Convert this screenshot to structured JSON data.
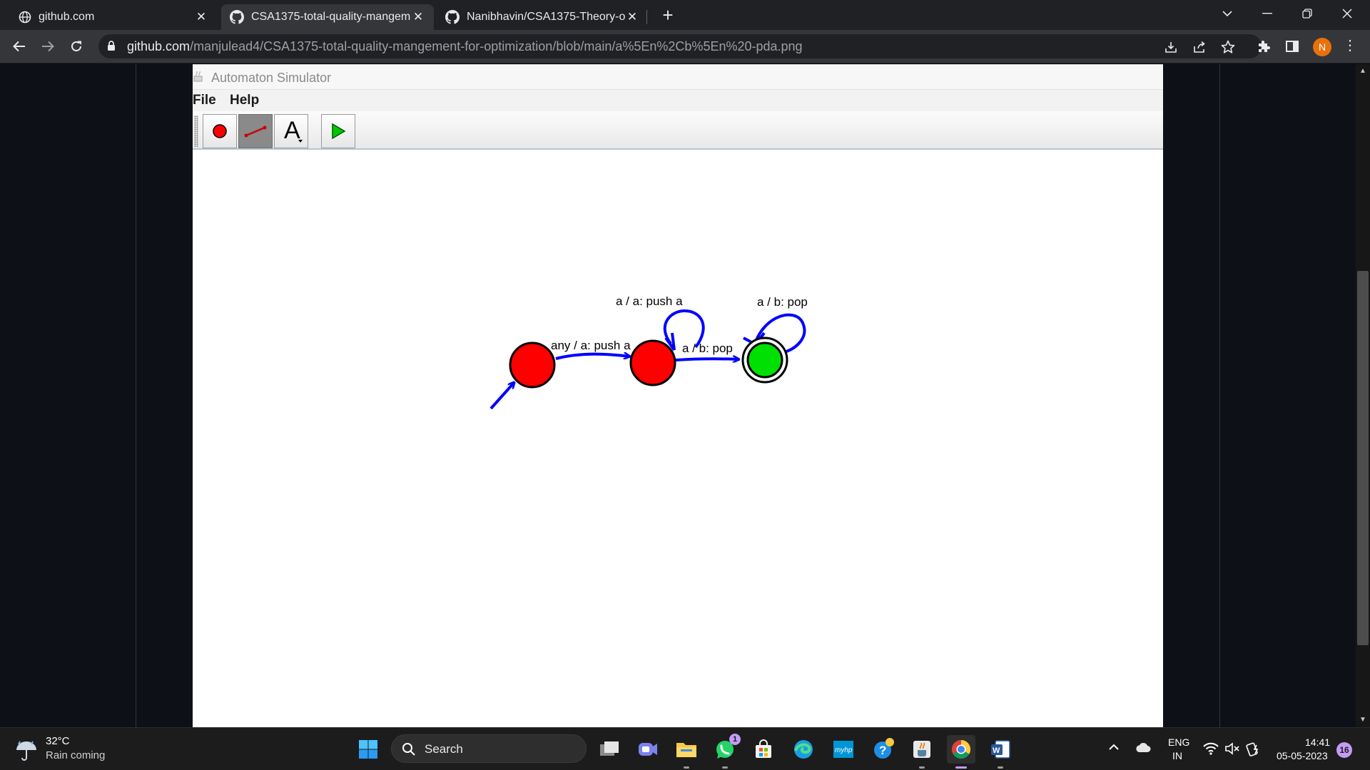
{
  "browser": {
    "tabs": [
      {
        "title": "github.com",
        "active": false
      },
      {
        "title": "CSA1375-total-quality-mangeme",
        "active": true
      },
      {
        "title": "Nanibhavin/CSA1375-Theory-of-",
        "active": false
      }
    ],
    "url": {
      "host": "github.com",
      "path": "/manjulead4/CSA1375-total-quality-mangement-for-optimization/blob/main/a%5En%2Cb%5En%20-pda.png"
    },
    "profile_initial": "N"
  },
  "app": {
    "title": "Automaton Simulator",
    "menu": [
      "File",
      "Help"
    ],
    "tools": [
      "state-tool",
      "transition-tool",
      "text-tool",
      "simulate-tool"
    ],
    "selected_tool": "transition-tool",
    "automaton": {
      "states": [
        {
          "id": "q0",
          "initial": true,
          "accepting": false,
          "color": "#ff0000"
        },
        {
          "id": "q1",
          "initial": false,
          "accepting": false,
          "color": "#ff0000"
        },
        {
          "id": "q2",
          "initial": false,
          "accepting": true,
          "color": "#00e000"
        }
      ],
      "transitions": [
        {
          "from": "q0",
          "to": "q1",
          "label": "any / a: push a"
        },
        {
          "from": "q1",
          "to": "q1",
          "label": "a / a: push a"
        },
        {
          "from": "q1",
          "to": "q2",
          "label": "a / b: pop"
        },
        {
          "from": "q2",
          "to": "q2",
          "label": "a / b: pop"
        }
      ],
      "edge_color": "#0000ff"
    }
  },
  "taskbar": {
    "weather": {
      "temp": "32°C",
      "desc": "Rain coming"
    },
    "search_label": "Search",
    "whatsapp_badge": "1",
    "language": [
      "ENG",
      "IN"
    ],
    "time": "14:41",
    "date": "05-05-2023",
    "notifications": "16"
  }
}
